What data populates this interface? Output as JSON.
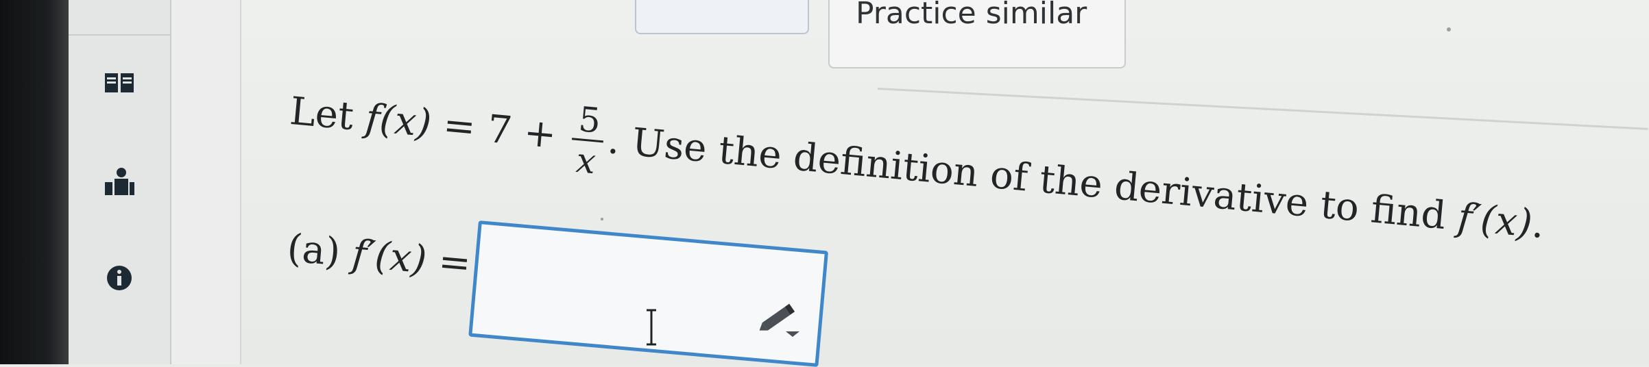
{
  "top": {
    "practice_label": "Practice similar"
  },
  "sidebar": {
    "items": [
      {
        "icon": "book-icon"
      },
      {
        "icon": "people-icon"
      },
      {
        "icon": "info-icon"
      }
    ]
  },
  "question": {
    "lead": "Let ",
    "fx": "f(x)",
    "eq": " = 7 + ",
    "frac_num": "5",
    "frac_den": "x",
    "tail": ". Use the definition of the derivative to find ",
    "target": "f′(x)",
    "end": "."
  },
  "part_a": {
    "label": "(a) ",
    "expr": "f′(x)",
    "eq": " ="
  },
  "answer": {
    "value": ""
  },
  "colors": {
    "accent": "#3f87c9",
    "text": "#222426"
  }
}
